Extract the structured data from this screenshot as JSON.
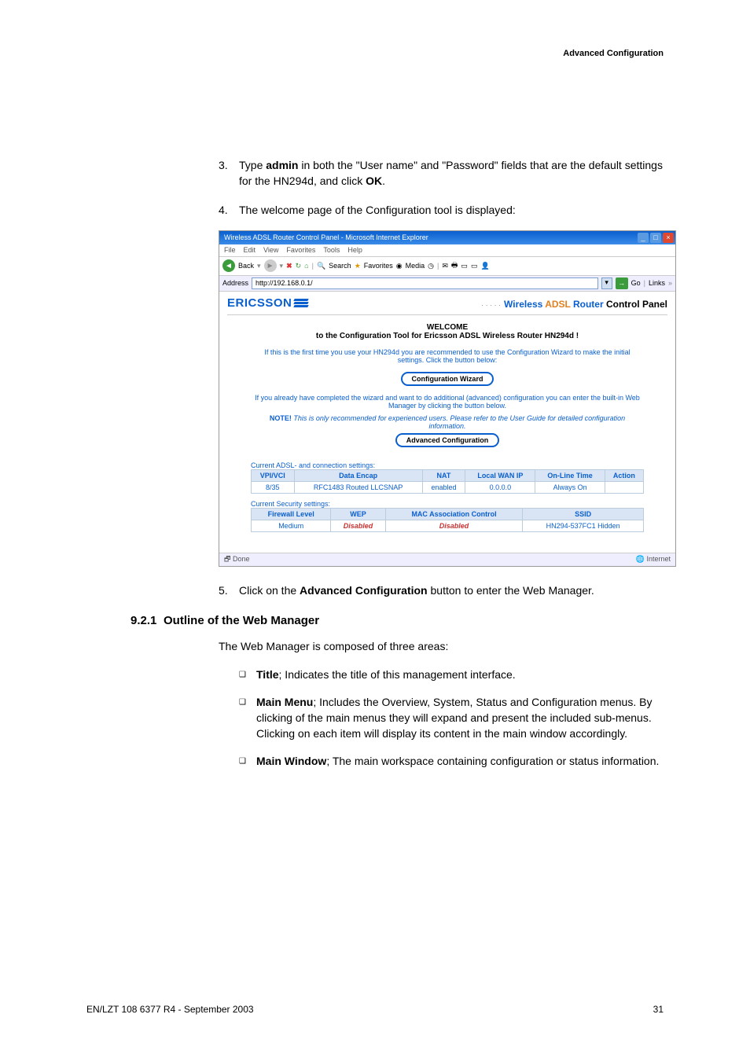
{
  "page_header": "Advanced Configuration",
  "steps": {
    "s3": {
      "num": "3.",
      "text": "Type admin in both the \"User name\" and \"Password\" fields that are the default settings for the HN294d, and click OK."
    },
    "s4": {
      "num": "4.",
      "text": "The welcome page of the Configuration tool is displayed:"
    },
    "s5": {
      "num": "5.",
      "text": "Click on the Advanced Configuration button to enter the Web Manager."
    }
  },
  "ie": {
    "title": "Wireless ADSL Router Control Panel - Microsoft Internet Explorer",
    "menu": {
      "file": "File",
      "edit": "Edit",
      "view": "View",
      "fav": "Favorites",
      "tools": "Tools",
      "help": "Help"
    },
    "toolbar": {
      "back": "Back",
      "search": "Search",
      "favorites": "Favorites",
      "media": "Media"
    },
    "addr_label": "Address",
    "addr_value": "http://192.168.0.1/",
    "go": "Go",
    "links": "Links",
    "status_done": "Done",
    "status_zone": "Internet"
  },
  "router": {
    "brand": "ERICSSON",
    "panel_title": "Wireless ADSL Router Control Panel",
    "welcome": "WELCOME",
    "subline": "to the Configuration Tool for Ericsson ADSL Wireless Router HN294d !",
    "para1": "If this is the first time you use your HN294d you are recommended to use the Configuration Wizard to make the initial settings. Click the button below:",
    "wizard_btn": "Configuration Wizard",
    "para2": "If you already have completed the wizard and want to do additional (advanced) configuration you can enter the built-in Web Manager by clicking the button below.",
    "note_lead": "NOTE!",
    "note_body": "This is only recommended for experienced users. Please refer to the User Guide for detailed configuration information.",
    "adv_btn": "Advanced Configuration",
    "cap1": "Current ADSL- and connection settings:",
    "cap2": "Current Security settings:",
    "t1": {
      "h1": "VPI/VCI",
      "h2": "Data Encap",
      "h3": "NAT",
      "h4": "Local WAN IP",
      "h5": "On-Line Time",
      "h6": "Action",
      "c1": "8/35",
      "c2": "RFC1483 Routed LLCSNAP",
      "c3": "enabled",
      "c4": "0.0.0.0",
      "c5": "Always On",
      "c6": ""
    },
    "t2": {
      "h1": "Firewall Level",
      "h2": "WEP",
      "h3": "MAC Association Control",
      "h4": "SSID",
      "c1": "Medium",
      "c2": "Disabled",
      "c3": "Disabled",
      "c4a": "HN294-537FC1",
      "c4b": "Hidden"
    }
  },
  "section": {
    "num": "9.2.1",
    "title": "Outline of the Web Manager"
  },
  "body_para": "The Web Manager is composed of three areas:",
  "bullets": {
    "b1": {
      "title": "Title",
      "text": "; Indicates the title of this management interface."
    },
    "b2": {
      "title": "Main Menu",
      "text": "; Includes the Overview, System, Status and Configuration menus. By clicking of the main menus they will expand and present the included sub-menus. Clicking on each item will display its content in the main window accordingly."
    },
    "b3": {
      "title": "Main Window",
      "text": "; The main workspace containing configuration or status information."
    }
  },
  "footer": {
    "left": "EN/LZT 108 6377 R4 - September 2003",
    "right": "31"
  }
}
